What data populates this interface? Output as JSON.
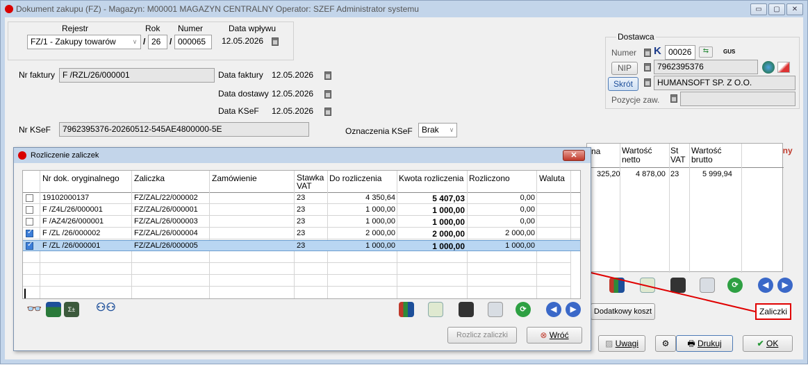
{
  "window": {
    "title": "Dokument zakupu (FZ) - Magazyn: M00001 MAGAZYN CENTRALNY  Operator: SZEF Administrator systemu",
    "buttons": [
      "▭",
      "▢",
      "✕"
    ]
  },
  "header": {
    "rejestr_label": "Rejestr",
    "rok_label": "Rok",
    "numer_label": "Numer",
    "data_wplywu_label": "Data wpływu",
    "rejestr_value": "FZ/1  - Zakupy towarów",
    "slash1": "/",
    "rok_value": "26",
    "slash2": "/",
    "numer_value": "000065",
    "data_wplywu_value": "12.05.2026",
    "nr_faktury_label": "Nr faktury",
    "nr_faktury_value": "F /RZL/26/000001",
    "data_faktury_label": "Data faktury",
    "data_faktury_value": "12.05.2026",
    "data_dostawy_label": "Data dostawy",
    "data_dostawy_value": "12.05.2026",
    "data_ksef_label": "Data KSeF",
    "data_ksef_value": "12.05.2026",
    "nr_ksef_label": "Nr KSeF",
    "nr_ksef_value": "7962395376-20260512-545AE4800000-5E",
    "oznaczenia_label": "Oznaczenia KSeF",
    "oznaczenia_value": "Brak"
  },
  "supplier": {
    "group_label": "Dostawca",
    "numer_label": "Numer",
    "k_label": "K",
    "numer_value": "00026",
    "gus_label": "GUS",
    "nip_label": "NIP",
    "nip_value": "7962395376",
    "skrot_label": "Skrót",
    "skrot_value": "HUMANSOFT SP. Z O.O.",
    "pozycje_label": "Pozycje zaw.",
    "pozycje_value": ""
  },
  "poufny_label": "Poufny",
  "right_grid": {
    "headers": [
      "na",
      "Wartość netto",
      "St VAT",
      "Wartość brutto"
    ],
    "row": [
      "325,20",
      "4 878,00",
      "23",
      "5 999,94"
    ]
  },
  "bottom_buttons": {
    "dodatkowy_koszt": "Dodatkowy koszt",
    "zaliczki": "Zaliczki",
    "uwagi": "Uwagi",
    "drukuj": "Drukuj",
    "ok": "OK"
  },
  "dialog": {
    "title": "Rozliczenie zaliczek",
    "close": "✕",
    "columns": [
      "Nr dok. oryginalnego",
      "Zaliczka",
      "Zamówienie",
      "Stawka VAT",
      "Do rozliczenia",
      "Kwota rozliczenia",
      "Rozliczono",
      "Waluta"
    ],
    "rows": [
      {
        "checked": false,
        "selected": false,
        "nr": "19102000137",
        "zaliczka": "FZ/ZAL/22/000002",
        "zamowienie": "",
        "vat": "23",
        "do_rozl": "4 350,64",
        "kwota": "5 407,03",
        "rozliczono": "0,00",
        "waluta": ""
      },
      {
        "checked": false,
        "selected": false,
        "nr": "F /Z4L/26/000001",
        "zaliczka": "FZ/ZAL/26/000001",
        "zamowienie": "",
        "vat": "23",
        "do_rozl": "1 000,00",
        "kwota": "1 000,00",
        "rozliczono": "0,00",
        "waluta": ""
      },
      {
        "checked": false,
        "selected": false,
        "nr": "F /AZ4/26/000001",
        "zaliczka": "FZ/ZAL/26/000003",
        "zamowienie": "",
        "vat": "23",
        "do_rozl": "1 000,00",
        "kwota": "1 000,00",
        "rozliczono": "0,00",
        "waluta": ""
      },
      {
        "checked": true,
        "selected": false,
        "nr": "F /ZL /26/000002",
        "zaliczka": "FZ/ZAL/26/000004",
        "zamowienie": "",
        "vat": "23",
        "do_rozl": "2 000,00",
        "kwota": "2 000,00",
        "rozliczono": "2 000,00",
        "waluta": ""
      },
      {
        "checked": true,
        "selected": true,
        "nr": "F /ZL /26/000001",
        "zaliczka": "FZ/ZAL/26/000005",
        "zamowienie": "",
        "vat": "23",
        "do_rozl": "1 000,00",
        "kwota": "1 000,00",
        "rozliczono": "1 000,00",
        "waluta": ""
      }
    ],
    "rozlicz_button": "Rozlicz zaliczki",
    "wroc_button": "Wróć"
  },
  "colors": {
    "title_bar": "#c3d5ea",
    "selected_row": "#b9d6f2",
    "arrow": "#e00000",
    "checkbox_on": "#3d7ed8"
  }
}
